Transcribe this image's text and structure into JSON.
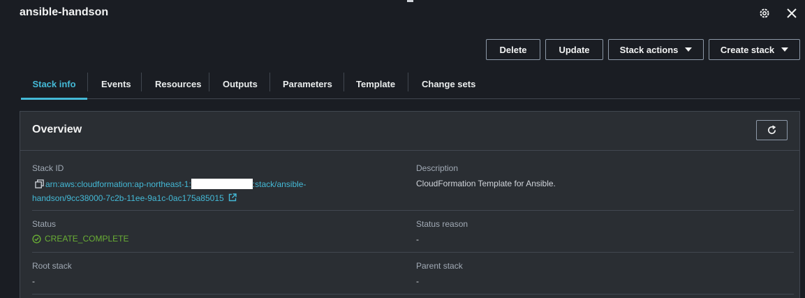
{
  "header": {
    "title": "ansible-handson"
  },
  "actions": {
    "delete_label": "Delete",
    "update_label": "Update",
    "stack_actions_label": "Stack actions",
    "create_stack_label": "Create stack"
  },
  "tabs": [
    {
      "label": "Stack info",
      "active": true
    },
    {
      "label": "Events"
    },
    {
      "label": "Resources"
    },
    {
      "label": "Outputs"
    },
    {
      "label": "Parameters"
    },
    {
      "label": "Template"
    },
    {
      "label": "Change sets"
    }
  ],
  "overview": {
    "title": "Overview",
    "stack_id": {
      "label": "Stack ID",
      "arn_prefix": "arn:aws:cloudformation:ap-northeast-1:",
      "arn_suffix": ":stack/ansible-",
      "arn_line2": "handson/9cc38000-7c2b-11ee-9a1c-0ac175a85015"
    },
    "description": {
      "label": "Description",
      "value": "CloudFormation Template for Ansible."
    },
    "status": {
      "label": "Status",
      "value": "CREATE_COMPLETE"
    },
    "status_reason": {
      "label": "Status reason",
      "value": "-"
    },
    "root_stack": {
      "label": "Root stack",
      "value": "-"
    },
    "parent_stack": {
      "label": "Parent stack",
      "value": "-"
    }
  },
  "colors": {
    "accent": "#44b9d6",
    "success": "#6aaf35",
    "background": "#1a1d23",
    "panel": "#2a2e33"
  }
}
